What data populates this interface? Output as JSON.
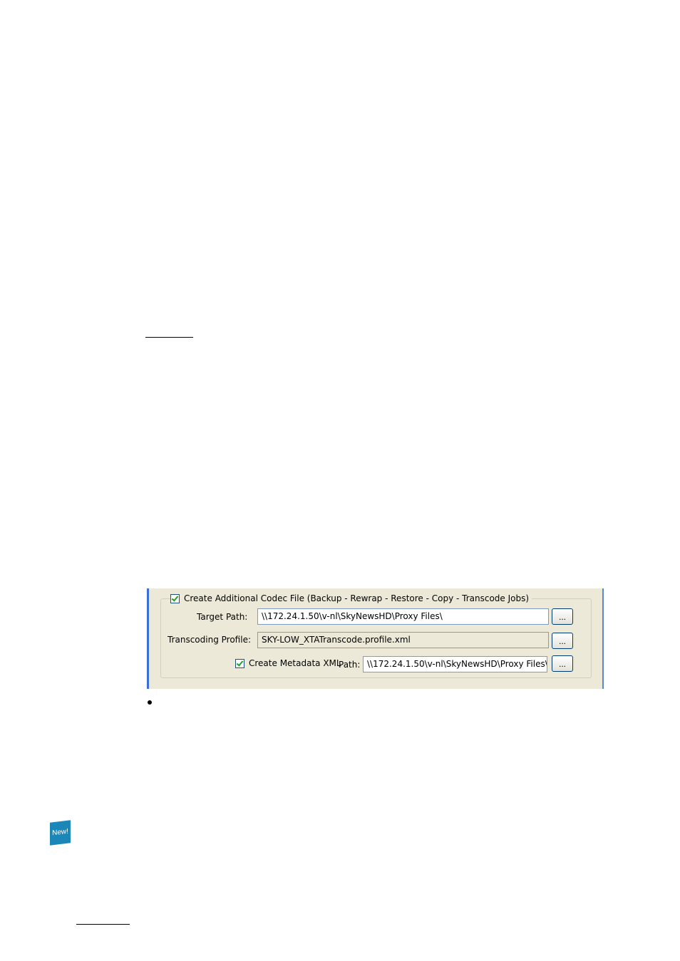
{
  "dialog": {
    "group_title": "Create Additional Codec File (Backup - Rewrap - Restore - Copy - Transcode Jobs)",
    "target_path": {
      "label": "Target Path:",
      "value": "\\\\172.24.1.50\\v-nl\\SkyNewsHD\\Proxy Files\\",
      "browse_label": "..."
    },
    "transcoding_profile": {
      "label": "Transcoding Profile:",
      "value": "SKY-LOW_XTATranscode.profile.xml",
      "browse_label": "..."
    },
    "metadata": {
      "checkbox_label": "Create Metadata XML",
      "path_label": "Path:",
      "path_value": "\\\\172.24.1.50\\v-nl\\SkyNewsHD\\Proxy Files\\",
      "browse_label": "..."
    }
  },
  "badge": {
    "text": "New!",
    "color": "#1b86b8"
  }
}
